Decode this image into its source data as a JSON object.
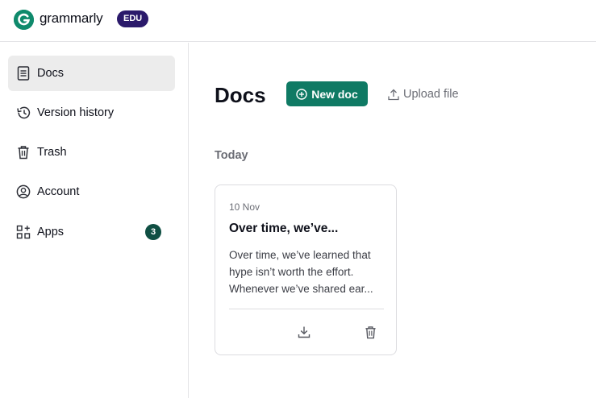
{
  "header": {
    "logo_text": "grammarly",
    "plan_badge": "EDU"
  },
  "sidebar": {
    "items": [
      {
        "label": "Docs",
        "icon": "document-icon",
        "active": true
      },
      {
        "label": "Version history",
        "icon": "history-icon",
        "active": false
      },
      {
        "label": "Trash",
        "icon": "trash-icon",
        "active": false
      },
      {
        "label": "Account",
        "icon": "account-icon",
        "active": false
      },
      {
        "label": "Apps",
        "icon": "apps-icon",
        "active": false,
        "badge": "3"
      }
    ]
  },
  "main": {
    "title": "Docs",
    "new_doc_label": "New doc",
    "upload_label": "Upload file",
    "section_label": "Today",
    "documents": [
      {
        "date": "10 Nov",
        "title": "Over time, we’ve...",
        "excerpt_lines": [
          "Over time, we’ve learned that",
          "hype isn’t worth the effort.",
          "Whenever we’ve shared ear..."
        ]
      }
    ]
  },
  "colors": {
    "brand_green": "#0f7a64",
    "edu_badge": "#2b1a6b",
    "active_nav": "#ececec"
  }
}
